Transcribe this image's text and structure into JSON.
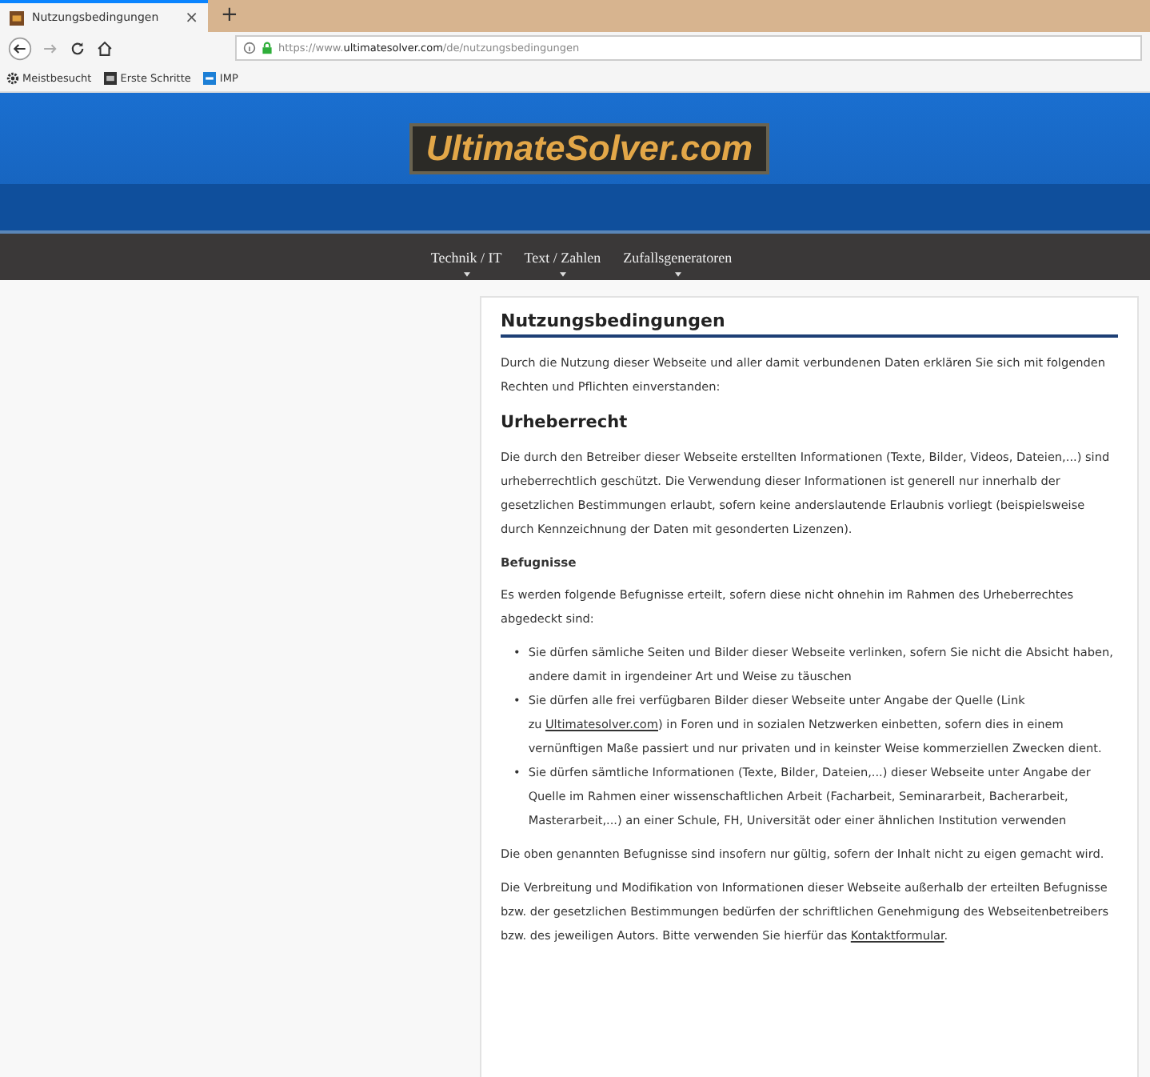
{
  "browser": {
    "tab": {
      "title": "Nutzungsbedingungen",
      "close": "×",
      "selected": true
    },
    "new_tab": "+",
    "url": {
      "prefix": "https://www.",
      "domain": "ultimatesolver.com",
      "path": "/de/nutzungsbedingungen"
    },
    "bookmarks": [
      {
        "label": "Meistbesucht",
        "kind": "gear"
      },
      {
        "label": "Erste Schritte",
        "kind": "dark"
      },
      {
        "label": "IMP",
        "kind": "blue"
      }
    ]
  },
  "site": {
    "logo": "UltimateSolver.com",
    "nav": [
      {
        "label": "Technik / IT"
      },
      {
        "label": "Text / Zahlen"
      },
      {
        "label": "Zufallsgeneratoren"
      }
    ]
  },
  "article": {
    "title": "Nutzungsbedingungen",
    "blocks": [
      {
        "kind": "p",
        "text": "Durch die Nutzung dieser Webseite und aller damit verbundenen Daten erklären Sie sich mit folgenden Rechten und Pflichten einverstanden:"
      },
      {
        "kind": "h2",
        "text": "Urheberrecht"
      },
      {
        "kind": "p",
        "text": "Die durch den Betreiber dieser Webseite erstellten Informationen (Texte, Bilder, Videos, Dateien,...) sind urheberrechtlich geschützt. Die Verwendung dieser Informationen ist generell nur innerhalb der gesetzlichen Bestimmungen erlaubt, sofern keine anderslautende Erlaubnis vorliegt (beispielsweise durch Kennzeichnung der Daten mit gesonderten Lizenzen)."
      },
      {
        "kind": "h3",
        "text": "Befugnisse"
      },
      {
        "kind": "p",
        "text": "Es werden folgende Befugnisse erteilt, sofern diese nicht ohnehin im Rahmen des Urheberrechtes abgedeckt sind:"
      },
      {
        "kind": "ul",
        "marker": "•",
        "items": [
          {
            "before": "Sie dürfen sämliche Seiten und Bilder dieser Webseite verlinken, sofern Sie nicht die Absicht haben, andere damit in irgendeiner Art und Weise zu täuschen"
          },
          {
            "before": "Sie dürfen alle frei verfügbaren Bilder dieser Webseite unter Angabe der Quelle (Link zu",
            "link": "Ultimatesolver.com",
            "after": ") in Foren und in sozialen Netzwerken einbetten, sofern dies in einem vernünftigen Maße passiert und nur privaten und in keinster Weise kommerziellen Zwecken dient."
          },
          {
            "before": "Sie dürfen sämtliche Informationen (Texte, Bilder, Dateien,...) dieser Webseite unter Angabe der Quelle im Rahmen einer wissenschaftlichen Arbeit (Facharbeit, Seminararbeit, Bacherarbeit, Masterarbeit,...) an einer Schule, FH, Universität oder einer ähnlichen Institution verwenden"
          }
        ]
      },
      {
        "kind": "p",
        "text": "Die oben genannten Befugnisse sind insofern nur gültig, sofern der Inhalt nicht zu eigen gemacht wird."
      },
      {
        "kind": "p",
        "text": "Die Verbreitung und Modifikation von Informationen dieser Webseite außerhalb der erteilten Befugnisse bzw. der gesetzlichen Bestimmungen bedürfen der schriftlichen Genehmigung des Webseitenbetreibers bzw. des jeweiligen Autors. Bitte verwenden Sie hierfür das",
        "link": "Kontaktformular",
        "after": "."
      }
    ]
  }
}
